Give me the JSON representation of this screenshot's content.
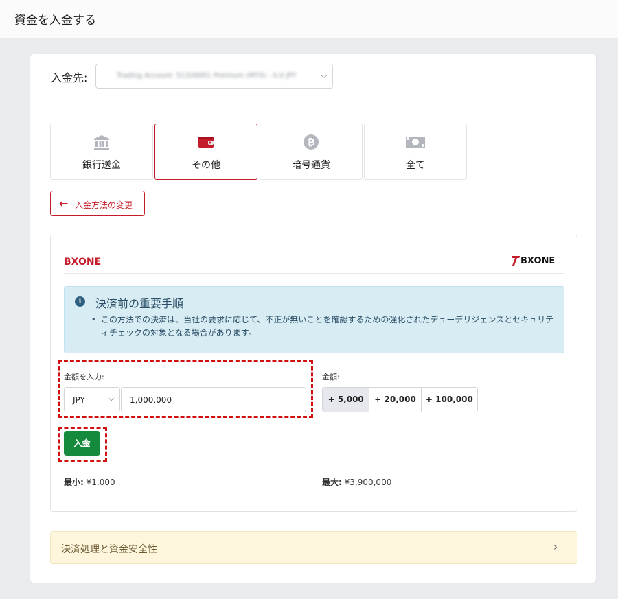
{
  "header": {
    "title": "資金を入金する"
  },
  "destination": {
    "label": "入金先:",
    "selected": "Trading Account: 51326951 Premium (MT4) - 0.0 JPY"
  },
  "tabs": [
    {
      "label": "銀行送金",
      "icon": "bank-icon",
      "active": false
    },
    {
      "label": "その他",
      "icon": "wallet-icon",
      "active": true
    },
    {
      "label": "暗号通貨",
      "icon": "bitcoin-icon",
      "active": false
    },
    {
      "label": "全て",
      "icon": "cash-icon",
      "active": false
    }
  ],
  "change_method": {
    "label": "入金方法の変更"
  },
  "method": {
    "title": "BXONE",
    "logo_text": "BXONE",
    "notice_title": "決済前の重要手順",
    "notice_body": "この方法での決済は、当社の要求に応じて、不正が無いことを確認するための強化されたデューデリジェンスとセキュリティチェックの対象となる場合があります。"
  },
  "amount": {
    "label": "金額を入力:",
    "currency": "JPY",
    "value": "1,000,000"
  },
  "quick": {
    "label": "金額:",
    "options": [
      "+ 5,000",
      "+ 20,000",
      "+ 100,000"
    ],
    "selected_index": 0
  },
  "deposit_button": "入金",
  "limits": {
    "min_label": "最小:",
    "min_value": " ¥1,000",
    "max_label": "最大:",
    "max_value": " ¥3,900,000"
  },
  "accordion": {
    "title": "決済処理と資金安全性"
  },
  "colors": {
    "brand_red": "#c51c2b",
    "success_green": "#168a3c",
    "info_bg": "#d8ecf4",
    "warning_bg": "#fdf5dc"
  }
}
